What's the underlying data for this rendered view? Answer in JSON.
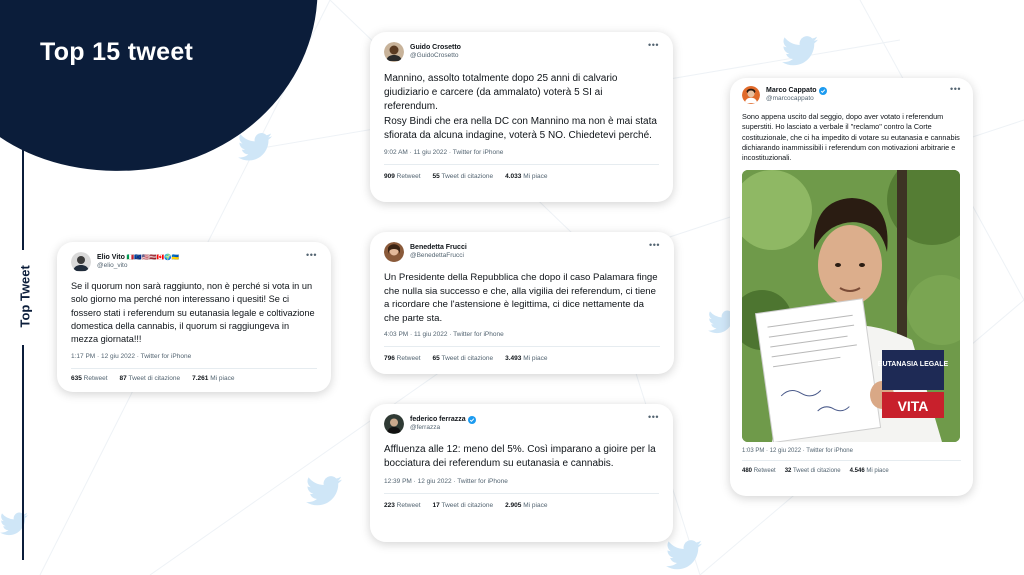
{
  "slide": {
    "title": "Top 15 tweet",
    "side_label": "Top Tweet"
  },
  "colors": {
    "navy": "#0b1d3a",
    "bird": "#cfe6f7",
    "verified": "#1d9bf0"
  },
  "tweets": {
    "vito": {
      "name": "Elio Vito",
      "flags": "🇮🇹🇪🇺🇺🇸🇱🇻🇨🇦🌍🇺🇦",
      "handle": "@elio_vito",
      "text": "Se il quorum non sarà raggiunto, non è perché si vota in un solo giorno ma perché non interessano i quesiti! Se ci fossero stati i referendum su eutanasia legale e coltivazione domestica della cannabis, il quorum si raggiungeva in mezza giornata!!!",
      "meta": "1:17 PM · 12 giu 2022 · Twitter for iPhone",
      "retweets": "635",
      "retweets_label": "Retweet",
      "quotes": "87",
      "quotes_label": "Tweet di citazione",
      "likes": "7.261",
      "likes_label": "Mi piace"
    },
    "crosetto": {
      "name": "Guido Crosetto",
      "handle": "@GuidoCrosetto",
      "text1": "Mannino, assolto totalmente dopo 25 anni di calvario giudiziario e carcere (da ammalato) voterà 5 SI ai referendum.",
      "text2": "Rosy Bindi che era nella DC con Mannino ma non è mai stata sfiorata da alcuna indagine, voterà 5 NO. Chiedetevi perché.",
      "meta": "9:02 AM · 11 giu 2022 · Twitter for iPhone",
      "retweets": "909",
      "retweets_label": "Retweet",
      "quotes": "55",
      "quotes_label": "Tweet di citazione",
      "likes": "4.033",
      "likes_label": "Mi piace"
    },
    "frucci": {
      "name": "Benedetta Frucci",
      "handle": "@BenedettaFrucci",
      "text": "Un Presidente della Repubblica che dopo il caso Palamara finge che nulla sia successo e che, alla vigilia dei referendum, ci tiene a ricordare che l'astensione è legittima, ci dice nettamente da che parte sta.",
      "meta": "4:03 PM · 11 giu 2022 · Twitter for iPhone",
      "retweets": "796",
      "retweets_label": "Retweet",
      "quotes": "65",
      "quotes_label": "Tweet di citazione",
      "likes": "3.493",
      "likes_label": "Mi piace"
    },
    "ferrazza": {
      "name": "federico ferrazza",
      "handle": "@ferrazza",
      "text": "Affluenza alle 12: meno del 5%. Così imparano a gioire per la bocciatura dei referendum su eutanasia e cannabis.",
      "meta": "12:39 PM · 12 giu 2022 · Twitter for iPhone",
      "retweets": "223",
      "retweets_label": "Retweet",
      "quotes": "17",
      "quotes_label": "Tweet di citazione",
      "likes": "2.905",
      "likes_label": "Mi piace"
    },
    "cappato": {
      "name": "Marco Cappato",
      "handle": "@marcocappato",
      "text": "Sono appena uscito dal seggio, dopo aver votato i referendum superstiti. Ho lasciato a verbale il \"reclamo\" contro la Corte costituzionale, che ci ha impedito di votare su eutanasia e cannabis dichiarando inammissibili i referendum con motivazioni arbitrarie e incostituzionali.",
      "shirt_text": "EUTANASIA LEGALE",
      "shirt_text2": "VITA",
      "meta": "1:03 PM · 12 giu 2022 · Twitter for iPhone",
      "retweets": "480",
      "retweets_label": "Retweet",
      "quotes": "32",
      "quotes_label": "Tweet di citazione",
      "likes": "4.546",
      "likes_label": "Mi piace"
    }
  }
}
